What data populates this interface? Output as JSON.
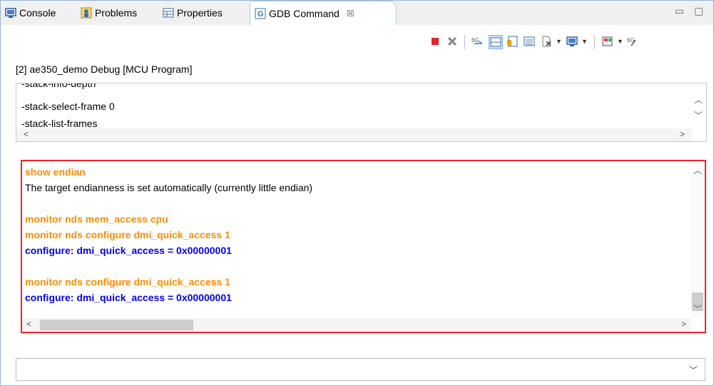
{
  "tabs": [
    {
      "label": "Console",
      "icon": "console-icon"
    },
    {
      "label": "Problems",
      "icon": "problems-icon"
    },
    {
      "label": "Properties",
      "icon": "properties-icon"
    },
    {
      "label": "GDB Command",
      "icon": "gdb-icon",
      "active": true,
      "close": "☒"
    }
  ],
  "window_controls": {
    "minimize": "▭",
    "maximize": "▢"
  },
  "toolbar_icons": [
    "stop-icon",
    "remove-all-icon",
    "gdb-trace-icon",
    "layout-horizontal-icon",
    "register-icon",
    "list-view-icon",
    "export-icon",
    "display-icon",
    "settings-icon",
    "connect-icon"
  ],
  "session_label": "[2] ae350_demo Debug [MCU Program]",
  "command_history": [
    "-stack-info-depth",
    "-stack-select-frame 0",
    "-stack-list-frames"
  ],
  "output_lines": [
    {
      "text": "show endian",
      "kind": "cmd"
    },
    {
      "text": "The target endianness is set automatically (currently little endian)",
      "kind": "info"
    },
    {
      "text": "",
      "kind": "blank"
    },
    {
      "text": "monitor nds mem_access cpu",
      "kind": "cmd"
    },
    {
      "text": "monitor nds configure dmi_quick_access 1",
      "kind": "cmd"
    },
    {
      "text": "configure: dmi_quick_access = 0x00000001",
      "kind": "resp"
    },
    {
      "text": "",
      "kind": "blank"
    },
    {
      "text": "monitor nds configure dmi_quick_access 1",
      "kind": "cmd"
    },
    {
      "text": "configure: dmi_quick_access = 0x00000001",
      "kind": "resp"
    }
  ],
  "input": {
    "value": "",
    "placeholder": ""
  },
  "colors": {
    "highlight_border": "#e8262b",
    "command": "#ff8c00",
    "response": "#0000ee"
  }
}
